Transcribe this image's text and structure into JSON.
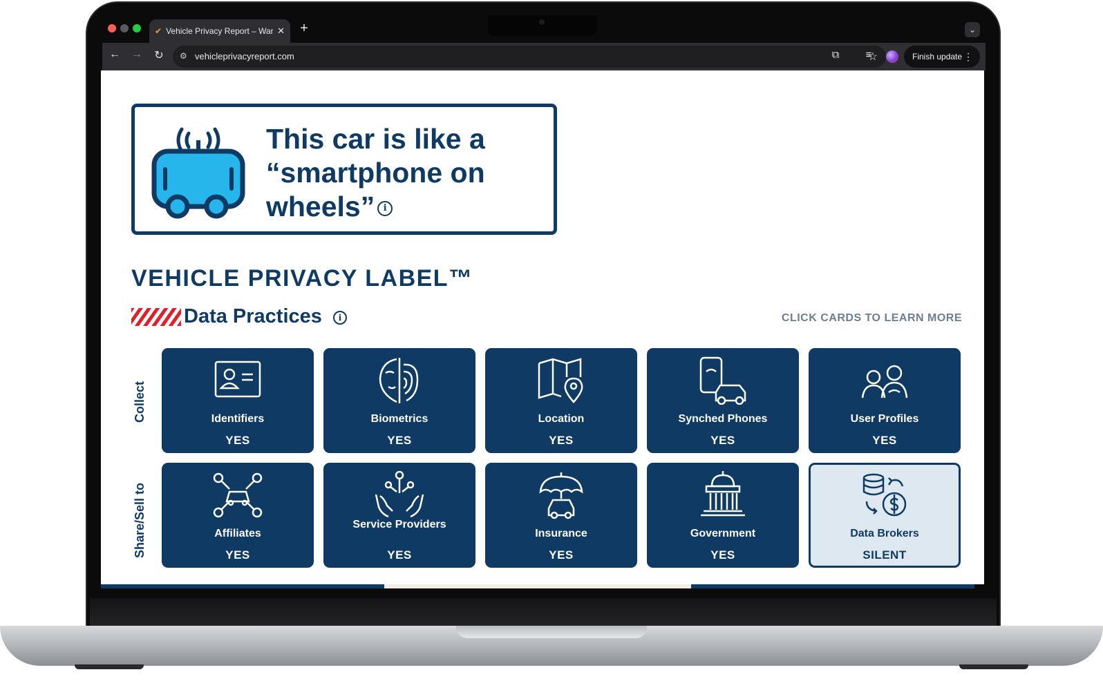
{
  "browser": {
    "tab_title": "Vehicle Privacy Report – War",
    "url": "vehicleprivacyreport.com",
    "new_tab": "+",
    "finish_update": "Finish update"
  },
  "hero": {
    "line1": "This car is like a",
    "line2": "“smartphone on",
    "line3": "wheels”",
    "info": "i"
  },
  "label": {
    "title": "VEHICLE PRIVACY LABEL™",
    "section_title": "Data Practices",
    "section_info": "i",
    "hint": "CLICK CARDS TO LEARN MORE"
  },
  "rows": {
    "collect": "Collect",
    "share": "Share/Sell to"
  },
  "collect_cards": [
    {
      "name": "Identifiers",
      "value": "YES",
      "icon": "id-card-icon"
    },
    {
      "name": "Biometrics",
      "value": "YES",
      "icon": "face-fingerprint-icon"
    },
    {
      "name": "Location",
      "value": "YES",
      "icon": "map-pin-icon"
    },
    {
      "name": "Synched Phones",
      "value": "YES",
      "icon": "phone-car-icon"
    },
    {
      "name": "User Profiles",
      "value": "YES",
      "icon": "users-icon"
    }
  ],
  "share_cards": [
    {
      "name": "Affiliates",
      "value": "YES",
      "icon": "network-car-icon"
    },
    {
      "name": "Service Providers",
      "value": "YES",
      "icon": "hands-network-icon"
    },
    {
      "name": "Insurance",
      "value": "YES",
      "icon": "umbrella-car-icon"
    },
    {
      "name": "Government",
      "value": "YES",
      "icon": "capitol-icon"
    },
    {
      "name": "Data Brokers",
      "value": "SILENT",
      "icon": "database-dollar-icon"
    }
  ],
  "colors": {
    "navy": "#0f3a63",
    "card_light": "#dde8f1",
    "accent_red": "#e0202a",
    "car_blue": "#27b6ec"
  }
}
